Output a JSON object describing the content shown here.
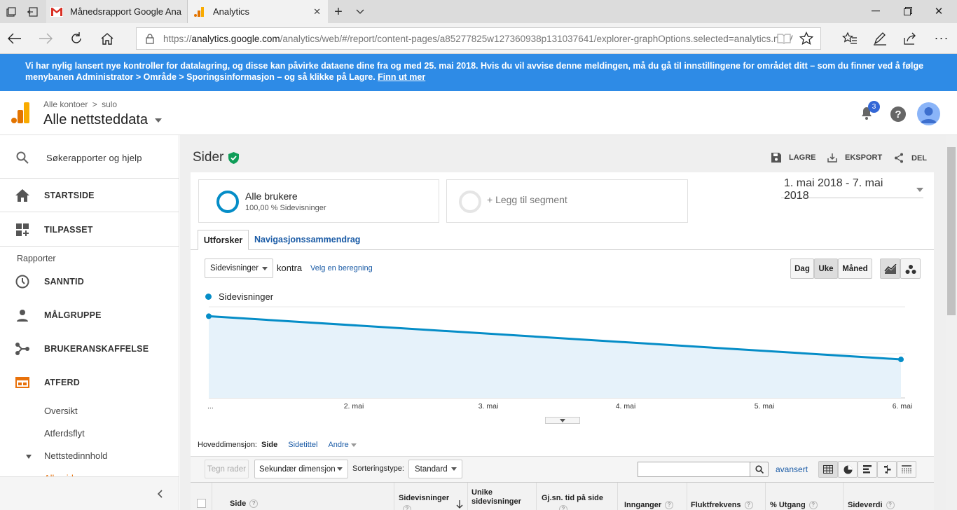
{
  "browser": {
    "tabs": [
      {
        "title": "Månedsrapport Google Ana",
        "favicon": "gmail-icon"
      },
      {
        "title": "Analytics",
        "favicon": "analytics-icon"
      }
    ],
    "url": {
      "prefix": "https://",
      "host": "analytics.google.com",
      "path": "/analytics/web/#/report/content-pages/a85277825w127360938p131037641/explorer-graphOptions.selected=analytics.nthV"
    }
  },
  "banner": {
    "text": "Vi har nylig lansert nye kontroller for datalagring, og disse kan påvirke dataene dine fra og med 25. mai 2018. Hvis du vil avvise denne meldingen, må du gå til innstillingene for området ditt – som du finner ved å følge menybanen Administrator > Område > Sporingsinformasjon – og så klikke på Lagre.",
    "link": "Finn ut mer"
  },
  "header": {
    "breadcrumb_root": "Alle kontoer",
    "breadcrumb_sep": ">",
    "breadcrumb_account": "sulo",
    "property": "Alle nettsteddata",
    "notification_count": "3"
  },
  "sidebar": {
    "search_label": "Søkerapporter og hjelp",
    "items": [
      {
        "label": "STARTSIDE",
        "icon": "home-icon"
      },
      {
        "label": "TILPASSET",
        "icon": "dashboard-icon"
      }
    ],
    "section_label": "Rapporter",
    "reports": [
      {
        "label": "SANNTID",
        "icon": "clock-icon"
      },
      {
        "label": "MÅLGRUPPE",
        "icon": "person-icon"
      },
      {
        "label": "BRUKERANSKAFFELSE",
        "icon": "acquisition-icon"
      },
      {
        "label": "ATFERD",
        "icon": "behavior-icon"
      }
    ],
    "subitems": [
      "Oversikt",
      "Atferdsflyt",
      "Nettstedinnhold"
    ],
    "cut_item": "Alle sider"
  },
  "report": {
    "title": "Sider",
    "actions": {
      "save": "LAGRE",
      "export": "EKSPORT",
      "share": "DEL"
    },
    "segment_name": "Alle brukere",
    "segment_sub": "100,00 % Sidevisninger",
    "add_segment": "+ Legg til segment",
    "date_range": "1. mai 2018 - 7. mai 2018",
    "tabs": [
      "Utforsker",
      "Navigasjonssammendrag"
    ],
    "metric_select": "Sidevisninger",
    "vs_label": "kontra",
    "choose_metric": "Velg en beregning",
    "granularity": [
      "Dag",
      "Uke",
      "Måned"
    ],
    "primary_dimension_label": "Hoveddimensjon:",
    "dimensions": [
      "Side",
      "Sidetittel"
    ],
    "dimensions_more": "Andre",
    "plot_rows": "Tegn rader",
    "secondary_dimension": "Sekundær dimensjon",
    "sort_label": "Sorteringstype:",
    "sort_value": "Standard",
    "advanced": "avansert",
    "columns": [
      "Side",
      "Sidevisninger",
      "Unike sidevisninger",
      "Gj.sn. tid på side",
      "Innganger",
      "Fluktfrekvens",
      "% Utgang",
      "Sideverdi"
    ]
  },
  "chart_data": {
    "type": "line",
    "series": [
      {
        "name": "Sidevisninger",
        "values": [
          180,
          88
        ]
      }
    ],
    "x": [
      "...",
      "6. mai"
    ],
    "x_ticks": [
      "...",
      "2. mai",
      "3. mai",
      "4. mai",
      "5. mai",
      "6. mai"
    ],
    "y_ticks": [
      "200",
      "100"
    ],
    "ylim": [
      0,
      200
    ],
    "color": "#058dc7",
    "fill": "#e6f2fa",
    "legend": "top-left",
    "grid": true
  }
}
